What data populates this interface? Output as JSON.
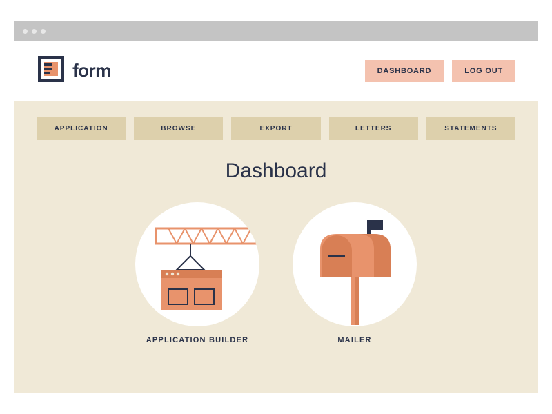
{
  "brand": "form",
  "header": {
    "dashboard": "DASHBOARD",
    "logout": "LOG OUT"
  },
  "tabs": [
    "APPLICATION",
    "BROWSE",
    "EXPORT",
    "LETTERS",
    "STATEMENTS"
  ],
  "page_title": "Dashboard",
  "tiles": {
    "app_builder": "APPLICATION BUILDER",
    "mailer": "MAILER"
  }
}
